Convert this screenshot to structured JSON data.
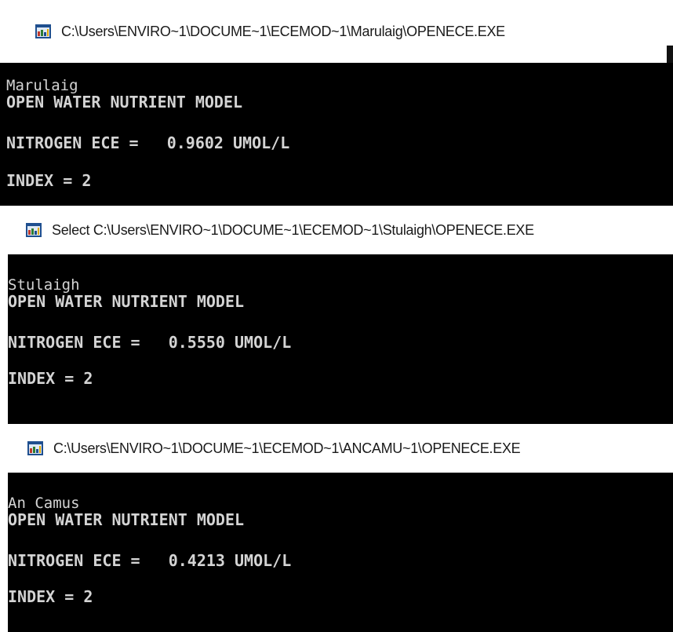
{
  "windows": [
    {
      "title": "C:\\Users\\ENVIRO~1\\DOCUME~1\\ECEMOD~1\\Marulaig\\OPENECE.EXE",
      "console": {
        "name": "Marulaig",
        "model": "OPEN WATER NUTRIENT MODEL",
        "nitrogen": "NITROGEN ECE =   0.9602 UMOL/L",
        "index": "INDEX = 2"
      }
    },
    {
      "title": "Select C:\\Users\\ENVIRO~1\\DOCUME~1\\ECEMOD~1\\Stulaigh\\OPENECE.EXE",
      "console": {
        "name": "Stulaigh",
        "model": "OPEN WATER NUTRIENT MODEL",
        "nitrogen": "NITROGEN ECE =   0.5550 UMOL/L",
        "index": "INDEX = 2"
      }
    },
    {
      "title": "C:\\Users\\ENVIRO~1\\DOCUME~1\\ECEMOD~1\\ANCAMU~1\\OPENECE.EXE",
      "console": {
        "name": "An Camus",
        "model": "OPEN WATER NUTRIENT MODEL",
        "nitrogen": "NITROGEN ECE =   0.4213 UMOL/L",
        "index": "INDEX = 2"
      }
    }
  ],
  "colors": {
    "console_bg": "#000000",
    "console_text": "#d4d4d4",
    "titlebar_bg": "#ffffff"
  },
  "icons": [
    "console-app-icon"
  ]
}
